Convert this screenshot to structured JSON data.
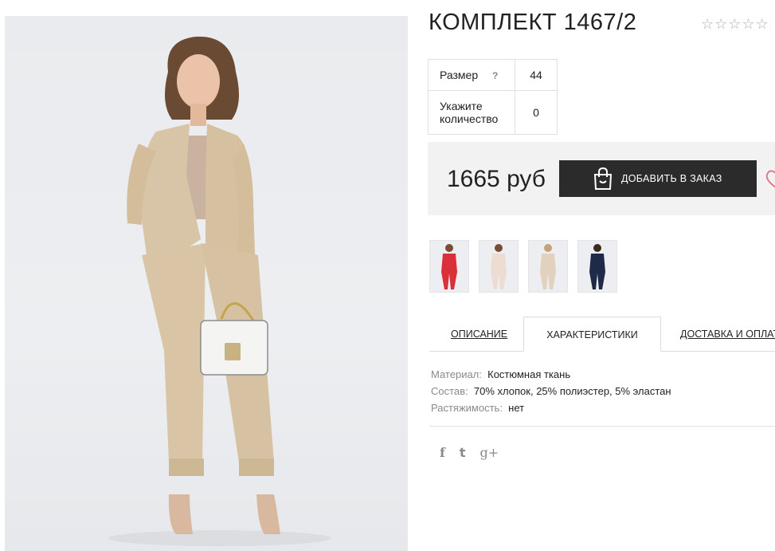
{
  "product": {
    "title": "КОМПЛЕКТ 1467/2",
    "rating_stars": [
      "☆",
      "☆",
      "☆",
      "☆",
      "☆"
    ]
  },
  "params": {
    "size_label": "Размер",
    "size_hint": "?",
    "size_value": "44",
    "qty_label": "Укажите количество",
    "qty_value": "0"
  },
  "buy": {
    "price": "1665 руб",
    "add_label": "ДОБАВИТЬ В ЗАКАЗ",
    "icons": [
      "shopping-bag-icon",
      "heart-icon"
    ],
    "accent_color": "#2b2b2b",
    "heart_color": "#e07a8a"
  },
  "thumbnails": [
    {
      "icon": "thumb-red-suit",
      "color": "#d9303a"
    },
    {
      "icon": "thumb-pink-suit",
      "color": "#eddcd2"
    },
    {
      "icon": "thumb-beige-suit",
      "color": "#e2d2bd"
    },
    {
      "icon": "thumb-navy-suit",
      "color": "#1f2a48"
    }
  ],
  "tabs": [
    {
      "label": "ОПИСАНИЕ"
    },
    {
      "label": "ХАРАКТЕРИСТИКИ"
    },
    {
      "label": "ДОСТАВКА И ОПЛАТА"
    }
  ],
  "specs": [
    {
      "key": "Материал:",
      "value": "Костюмная ткань"
    },
    {
      "key": "Состав:",
      "value": "70% хлопок, 25% полиэстер, 5% эластан"
    },
    {
      "key": "Растяжимость:",
      "value": "нет"
    }
  ],
  "social": [
    "f",
    "t",
    "g+"
  ]
}
